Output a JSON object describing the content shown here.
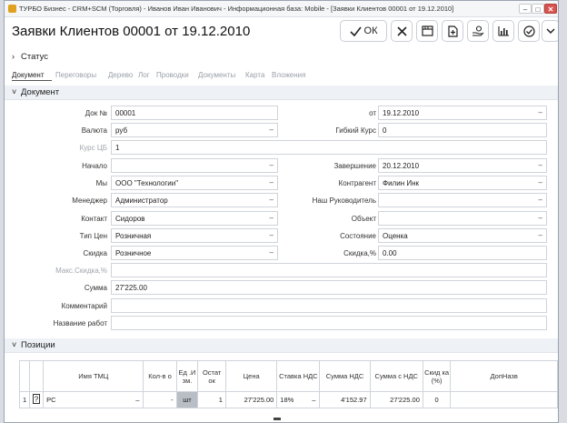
{
  "window": {
    "title": "ТУРБО Бизнес - CRM+SCM (Торговля) - Иванов Иван Иванович - Информационная база: Mobile - [Заявки Клиентов 00001 от 19.12.2010]",
    "min": "–",
    "max": "□",
    "close": "✕"
  },
  "header": {
    "title": "Заявки Клиентов 00001 от 19.12.2010",
    "ok_label": "ОК"
  },
  "sections": {
    "status": "Статус",
    "document": "Документ",
    "positions": "Позиции",
    "chev_collapsed": "›",
    "chev_open": "˅"
  },
  "tabs": [
    "Документ",
    "Переговоры",
    "Дерево",
    "Лог",
    "Проводки",
    "Документы",
    "Карта",
    "Вложения"
  ],
  "form": {
    "doc_no": {
      "label": "Док №",
      "value": "00001"
    },
    "date": {
      "label": "от",
      "value": "19.12.2010"
    },
    "currency": {
      "label": "Валюта",
      "value": "руб"
    },
    "flex_rate": {
      "label": "Гибкий Курс",
      "value": "0"
    },
    "cb_rate": {
      "label": "Курс ЦБ",
      "value": "1"
    },
    "start": {
      "label": "Начало",
      "value": ""
    },
    "end": {
      "label": "Завершение",
      "value": "20.12.2010"
    },
    "we": {
      "label": "Мы",
      "value": "ООО \"Технологии\""
    },
    "counterparty": {
      "label": "Контрагент",
      "value": "Филин Инк"
    },
    "manager": {
      "label": "Менеджер",
      "value": "Администратор"
    },
    "our_head": {
      "label": "Наш Руководитель",
      "value": ""
    },
    "contact": {
      "label": "Контакт",
      "value": "Сидоров"
    },
    "object": {
      "label": "Объект",
      "value": ""
    },
    "price_type": {
      "label": "Тип Цен",
      "value": "Розничная"
    },
    "state": {
      "label": "Состояние",
      "value": "Оценка"
    },
    "discount": {
      "label": "Скидка",
      "value": "Розничное"
    },
    "discount_pct": {
      "label": "Скидка,%",
      "value": "0.00"
    },
    "max_discount": {
      "label": "Макс.Скидка,%",
      "value": ""
    },
    "sum": {
      "label": "Сумма",
      "value": "27'225.00"
    },
    "comment": {
      "label": "Комментарий",
      "value": ""
    },
    "work_name": {
      "label": "Название работ",
      "value": ""
    },
    "dropdown_glyph": "–"
  },
  "table": {
    "columns": [
      "",
      "",
      "Имя ТМЦ",
      "Кол-во",
      "Ед.Изм.",
      "Остаток",
      "Цена",
      "Ставка НДС",
      "Сумма НДС",
      "Сумма с НДС",
      "Скидка (%)",
      "ДопНазв"
    ],
    "headers_display": {
      "name": "Имя ТМЦ",
      "qty": "Кол-в о",
      "unit": "Ед .И зм.",
      "rest": "Остат ок",
      "price": "Цена",
      "vat_rate": "Ставка НДС",
      "vat_sum": "Сумма НДС",
      "sum_vat": "Сумма с НДС",
      "disc": "Скид ка (%)",
      "extra": "ДопНазв"
    },
    "rows": [
      {
        "n": "1",
        "name": "PC",
        "name_dd": "–",
        "qty": "-",
        "unit": "шт",
        "rest": "1",
        "price": "27'225.00",
        "vat_rate": "18%",
        "vat_dd": "–",
        "vat_sum": "4'152.97",
        "sum_vat": "27'225.00",
        "disc": "0"
      }
    ]
  }
}
